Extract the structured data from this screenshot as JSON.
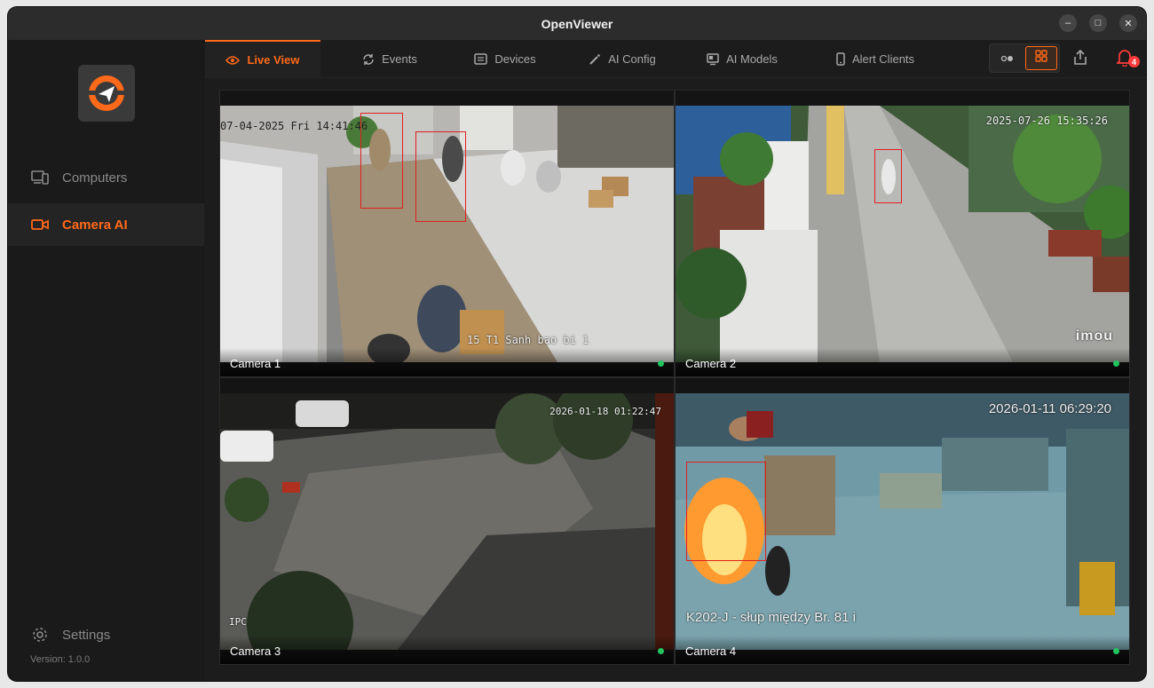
{
  "window": {
    "title": "OpenViewer",
    "min_label": "–",
    "max_label": "□",
    "close_label": "✕"
  },
  "sidebar": {
    "logo_icon": "openviewer-logo-icon",
    "items": [
      {
        "label": "Computers",
        "icon": "computers-icon",
        "active": false
      },
      {
        "label": "Camera AI",
        "icon": "camera-icon",
        "active": true
      }
    ],
    "settings_label": "Settings",
    "version": "Version: 1.0.0"
  },
  "tabs": [
    {
      "label": "Live View",
      "icon": "eye-icon",
      "active": true
    },
    {
      "label": "Events",
      "icon": "refresh-icon"
    },
    {
      "label": "Devices",
      "icon": "devices-icon"
    },
    {
      "label": "AI Config",
      "icon": "wand-icon"
    },
    {
      "label": "AI Models",
      "icon": "model-icon"
    },
    {
      "label": "Alert Clients",
      "icon": "phone-icon"
    }
  ],
  "notifications": {
    "count": "4"
  },
  "accent_color": "#ff6a1a",
  "cameras": [
    {
      "name": "Camera 1",
      "status": "online",
      "timestamp": "07-04-2025 Fri 14:41:46",
      "overlay": "15 T1 Sanh bao bi 1"
    },
    {
      "name": "Camera 2",
      "status": "online",
      "timestamp": "2025-07-26 15:35:26",
      "watermark": "imou"
    },
    {
      "name": "Camera 3",
      "status": "online",
      "timestamp": "2026-01-18 01:22:47",
      "overlay": "IPC"
    },
    {
      "name": "Camera 4",
      "status": "online",
      "timestamp": "2026-01-11 06:29:20",
      "overlay": "K202-J - słup między Br. 81 i"
    }
  ]
}
